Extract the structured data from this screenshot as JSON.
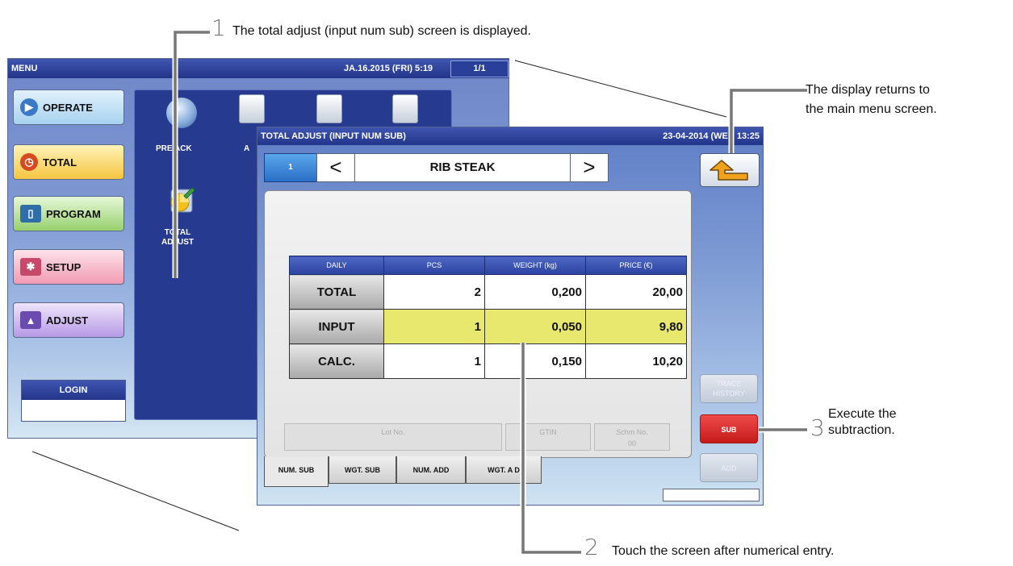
{
  "menu_screen": {
    "title": "MENU",
    "datetime": "JA.16.2015 (FRI)  5:19",
    "page": "1/1",
    "buttons": [
      "OPERATE",
      "TOTAL",
      "PROGRAM",
      "SETUP",
      "ADJUST"
    ],
    "panel": {
      "prepack_label": "PRE ACK",
      "a_label": "A",
      "total_adjust_label_line1": "TOTAL",
      "total_adjust_label_line2": "ADJUST"
    },
    "login_label": "LOGIN"
  },
  "total_adjust_screen": {
    "title": "TOTAL ADJUST (INPUT NUM SUB)",
    "datetime": "23-04-2014 (WED  13:25",
    "plu_number": "1",
    "prev_symbol": "<",
    "item_name": "RIB STEAK",
    "next_symbol": ">",
    "table": {
      "headers": [
        "DAILY",
        "PCS",
        "WEIGHT (kg)",
        "PRICE (€)"
      ],
      "rows": [
        {
          "label": "TOTAL",
          "pcs": "2",
          "weight": "0,200",
          "price": "20,00"
        },
        {
          "label": "INPUT",
          "pcs": "1",
          "weight": "0,050",
          "price": "9,80"
        },
        {
          "label": "CALC.",
          "pcs": "1",
          "weight": "0,150",
          "price": "10,20"
        }
      ]
    },
    "info": {
      "lot_label": "Lot No.",
      "gtin_label": "GTIN",
      "schm_label": "Schm No.",
      "schm_value": "00"
    },
    "tabs": [
      "NUM. SUB",
      "WGT. SUB",
      "NUM. ADD",
      "WGT. A D"
    ],
    "side_buttons": {
      "trace_line1": "TRACE",
      "trace_line2": "HISTORY",
      "sub": "SUB",
      "add": "ADD"
    }
  },
  "annotations": {
    "step1_num": "1",
    "step1_text": "The total adjust (input num sub) screen is displayed.",
    "step2_num": "2",
    "step2_text": "Touch the screen after numerical entry.",
    "step3_num": "3",
    "step3_text_line1": "Execute the",
    "step3_text_line2": "subtraction.",
    "return_text_line1": "The display returns to",
    "return_text_line2": "the main menu screen."
  }
}
